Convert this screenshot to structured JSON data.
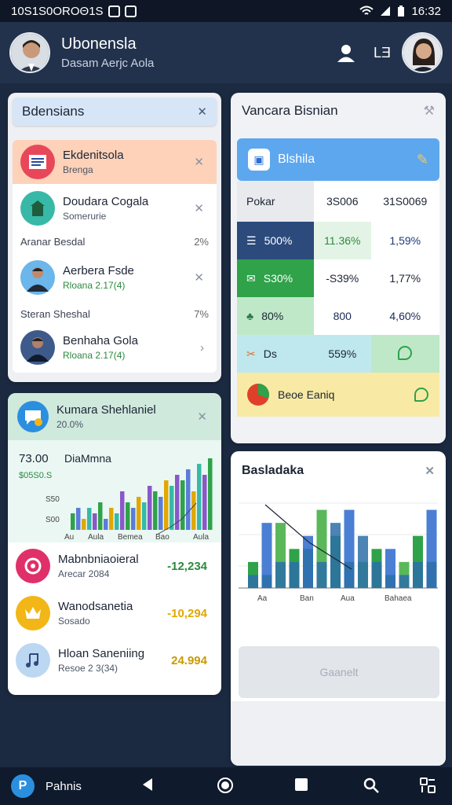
{
  "status": {
    "left_text": "10S1S0OROΘ1S",
    "time": "16:32"
  },
  "header": {
    "title": "Ubonensla",
    "subtitle": "Dasam Aerjc Aola",
    "action_label": "LƎ"
  },
  "left_panel": {
    "title": "Bdensians",
    "rows": [
      {
        "title": "Ekdenitsola",
        "subtitle": "Brenga",
        "icon": "document-icon"
      },
      {
        "title": "Doudara Cogala",
        "subtitle": "Somerurie",
        "icon": "building-icon"
      },
      {
        "title": "Aerbera Fsde",
        "subtitle": "Rloana 2.17(4)",
        "icon": "person-icon"
      },
      {
        "title": "Benhaha Gola",
        "subtitle": "Rloana 2.17(4)",
        "icon": "person-icon"
      }
    ],
    "separators": [
      {
        "label": "Aranar Besdal",
        "value": "2%"
      },
      {
        "label": "Steran Sheshal",
        "value": "7%"
      }
    ]
  },
  "activity_panel": {
    "title": "Kumara Shehlaniel",
    "subtitle": "20.0%",
    "chart_title": "DiaMmna",
    "chart_value": "73.00",
    "chart_yticks": [
      "$05S0.S",
      "S50",
      "S00"
    ],
    "chart_xticks": [
      "Au",
      "Aula",
      "Bemea",
      "Bao",
      "Aula"
    ],
    "rows": [
      {
        "title": "Mabnbniaoieral",
        "subtitle": "Arecar 2084",
        "value": "-12,234",
        "value_color": "#2b8a3e",
        "icon_color": "#e0306a"
      },
      {
        "title": "Wanodsanetia",
        "subtitle": "Sosado",
        "value": "-10,294",
        "value_color": "#e0a800",
        "icon_color": "#f2b616"
      },
      {
        "title": "Hloan Saneniing",
        "subtitle": "Resoe 2 3(34)",
        "value": "24.994",
        "value_color": "#c99a00",
        "icon_color": "#bcd7f2"
      }
    ]
  },
  "right_panel": {
    "title": "Vancara Bisnian",
    "banner": "Blshila",
    "header_row": {
      "label": "Pokar",
      "col1": "3S006",
      "col2": "3​1S0069"
    },
    "rows": [
      {
        "label": "500%",
        "v1": "11.36%",
        "v2": "1,59%",
        "label_bg": "#2c4a7c",
        "v1_color": "#2b8a3e",
        "v2_color": "#1c3a7a"
      },
      {
        "label": "S30%",
        "v1": "-S39%",
        "v2": "1,77%",
        "label_bg": "#2fa24a",
        "v1_color": "#1c2433",
        "v2_color": "#1c2433"
      },
      {
        "label": "80%",
        "v1": "800",
        "v2": "4,60%",
        "label_bg": "#bfe8c8",
        "v1_color": "#1c2a55",
        "v2_color": "#1c2a55"
      },
      {
        "label": "Ds",
        "v1": "559%",
        "v2": "",
        "label_bg": "#bfe8ee",
        "v1_color": "#1c2433",
        "v2_color": "#1c2433"
      }
    ],
    "footer_label": "Beoe Eaniq"
  },
  "analysis_panel": {
    "title": "Basladaka",
    "x_labels": [
      "Aa",
      "Ban",
      "Aua",
      "Bahaea"
    ],
    "button_label": "Gaanelt",
    "chart_data": {
      "type": "bar",
      "categories": [
        "1",
        "2",
        "3",
        "4",
        "5",
        "6",
        "7",
        "8",
        "9",
        "10",
        "11",
        "12",
        "13",
        "14"
      ],
      "series": [
        {
          "values": [
            2,
            5,
            5,
            3,
            4,
            6,
            4,
            6,
            2,
            3,
            3,
            2,
            4,
            6
          ]
        },
        {
          "values": [
            1,
            1,
            2,
            2,
            3,
            2,
            5,
            2,
            4,
            2,
            1,
            1,
            2,
            2
          ]
        }
      ],
      "ylim": [
        0,
        7
      ]
    }
  },
  "nav": {
    "label": "Pahnis"
  },
  "colors": {
    "accent": "#2b8fe0",
    "header": "#22324c",
    "background": "#1c2a41"
  }
}
